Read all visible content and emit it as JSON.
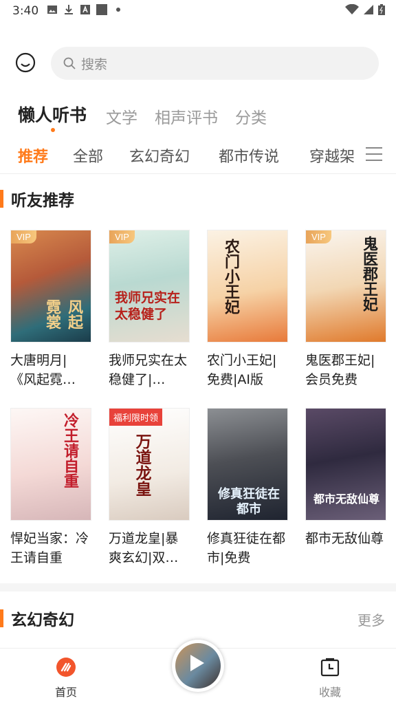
{
  "status_bar": {
    "time": "3:40"
  },
  "search": {
    "placeholder": "搜索"
  },
  "top_tabs": [
    {
      "label": "懒人听书",
      "active": true
    },
    {
      "label": "文学",
      "active": false
    },
    {
      "label": "相声评书",
      "active": false
    },
    {
      "label": "分类",
      "active": false
    }
  ],
  "categories": [
    {
      "label": "推荐",
      "active": true
    },
    {
      "label": "全部"
    },
    {
      "label": "玄幻奇幻"
    },
    {
      "label": "都市传说"
    },
    {
      "label": "穿越架"
    }
  ],
  "sections": [
    {
      "title": "听友推荐",
      "books": [
        {
          "title": "大唐明月|《风起霓…",
          "badge": "VIP",
          "cover_text": "风起霓裳"
        },
        {
          "title": "我师兄实在太稳健了|…",
          "badge": "VIP",
          "cover_text": "我师兄实在太稳健了"
        },
        {
          "title": "农门小王妃|免费|AI版",
          "badge": "",
          "cover_text": "农门小王妃"
        },
        {
          "title": "鬼医郡王妃|会员免费",
          "badge": "VIP",
          "cover_text": "鬼医郡王妃"
        },
        {
          "title": "悍妃当家：冷王请自重",
          "badge": "",
          "cover_text": "冷王请自重"
        },
        {
          "title": "万道龙皇|暴爽玄幻|双…",
          "badge": "福利限时领",
          "cover_text": "万道龙皇"
        },
        {
          "title": "修真狂徒在都市|免费",
          "badge": "",
          "cover_text": "修真狂徒在都市"
        },
        {
          "title": "都市无敌仙尊",
          "badge": "",
          "cover_text": "都市无敌仙尊"
        }
      ]
    },
    {
      "title": "玄幻奇幻",
      "more": "更多"
    }
  ],
  "bottom_nav": [
    {
      "label": "首页",
      "icon": "home-icon"
    },
    {
      "label": "收藏",
      "icon": "bookmark-clock-icon"
    }
  ],
  "colors": {
    "accent": "#ff7a1a",
    "vip": "#f0b56a",
    "promo": "#e8423a"
  }
}
